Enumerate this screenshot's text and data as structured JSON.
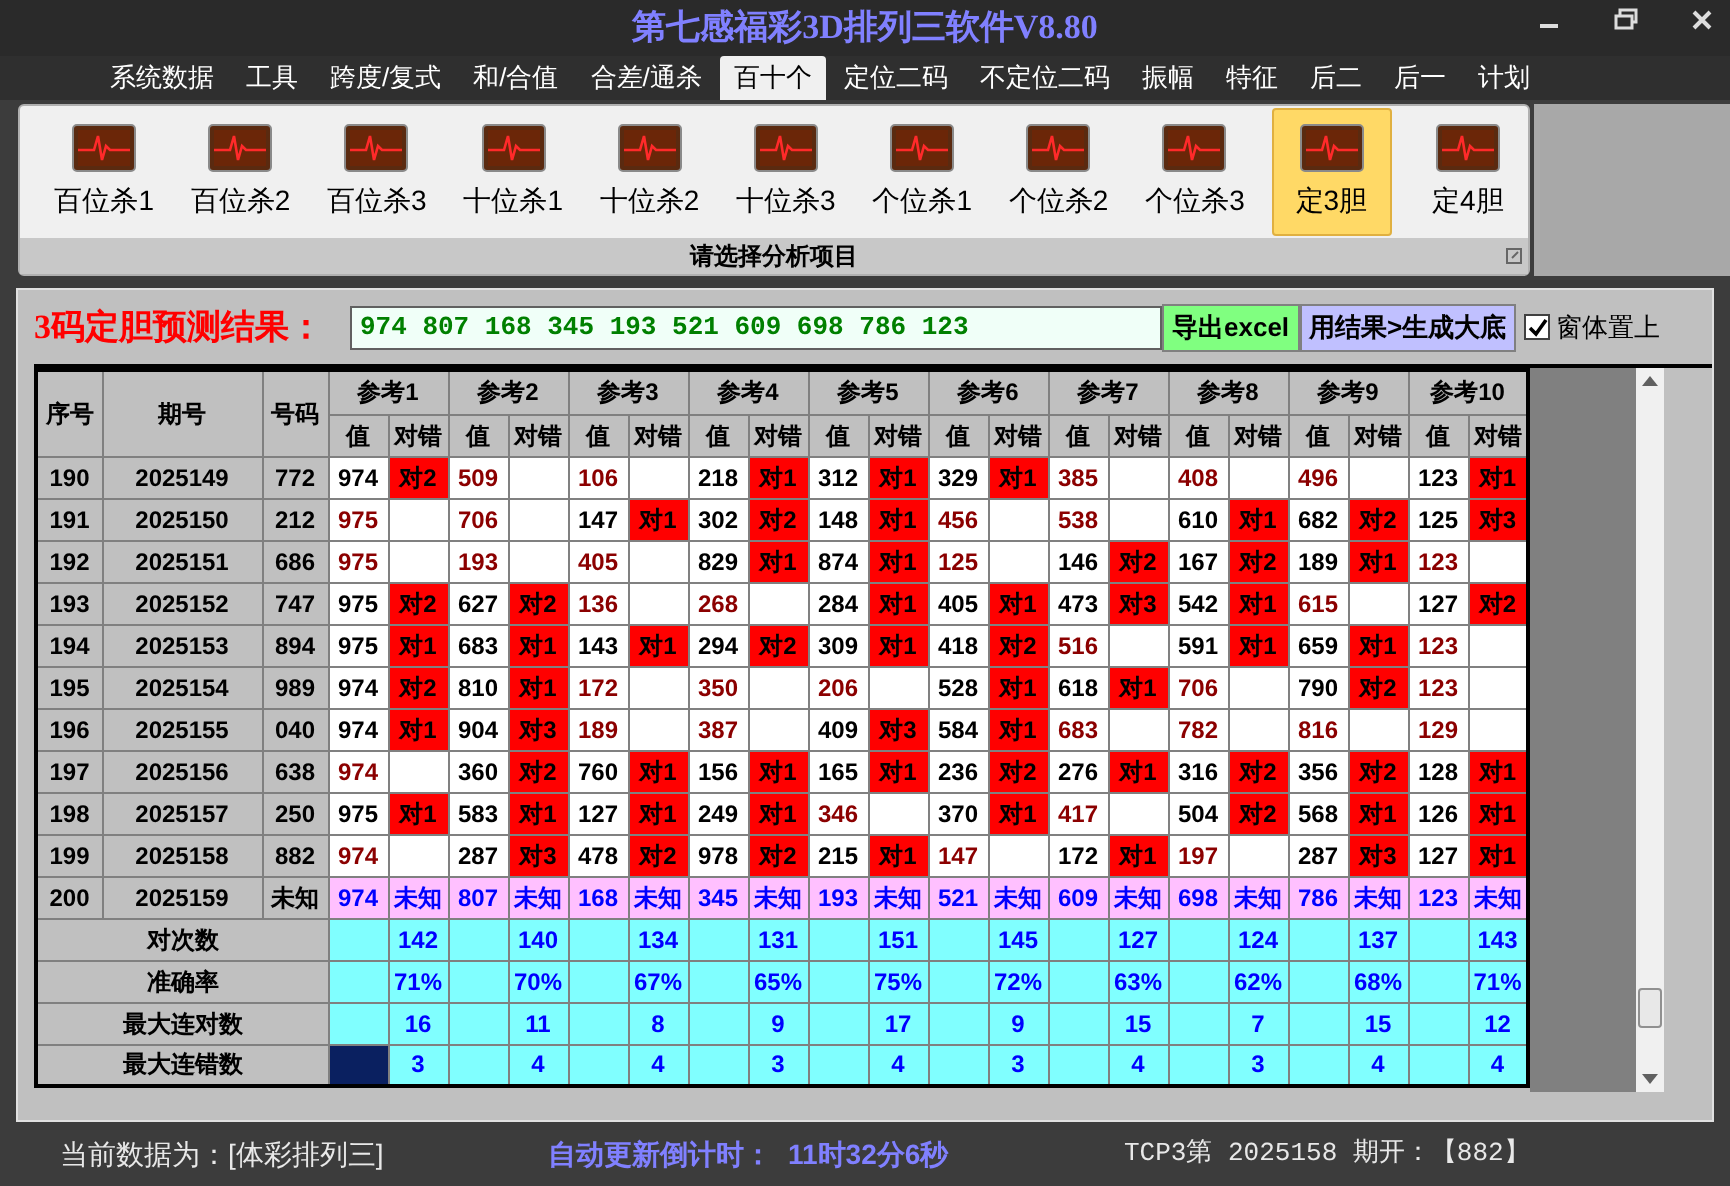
{
  "window": {
    "title": "第七感福彩3D排列三软件V8.80"
  },
  "menu": [
    {
      "label": "系统数据",
      "selected": false
    },
    {
      "label": "工具",
      "selected": false
    },
    {
      "label": "跨度/复式",
      "selected": false
    },
    {
      "label": "和/合值",
      "selected": false
    },
    {
      "label": "合差/通杀",
      "selected": false
    },
    {
      "label": "百十个",
      "selected": true
    },
    {
      "label": "定位二码",
      "selected": false
    },
    {
      "label": "不定位二码",
      "selected": false
    },
    {
      "label": "振幅",
      "selected": false
    },
    {
      "label": "特征",
      "selected": false
    },
    {
      "label": "后二",
      "selected": false
    },
    {
      "label": "后一",
      "selected": false
    },
    {
      "label": "计划",
      "selected": false
    }
  ],
  "ribbon": {
    "items": [
      {
        "label": "百位杀1",
        "selected": false
      },
      {
        "label": "百位杀2",
        "selected": false
      },
      {
        "label": "百位杀3",
        "selected": false
      },
      {
        "label": "十位杀1",
        "selected": false
      },
      {
        "label": "十位杀2",
        "selected": false
      },
      {
        "label": "十位杀3",
        "selected": false
      },
      {
        "label": "个位杀1",
        "selected": false
      },
      {
        "label": "个位杀2",
        "selected": false
      },
      {
        "label": "个位杀3",
        "selected": false
      },
      {
        "label": "定3胆",
        "selected": true
      },
      {
        "label": "定4胆",
        "selected": false
      }
    ],
    "group_label": "请选择分析项目"
  },
  "result": {
    "label": "3码定胆预测结果：",
    "value": "974 807 168 345 193 521 609 698 786 123",
    "buttons": [
      {
        "label": "导出excel",
        "kind": "export"
      },
      {
        "label": "用结果>生成大底",
        "kind": "generate"
      }
    ],
    "topmost": {
      "label": "窗体置上",
      "checked": true
    }
  },
  "table": {
    "columns": [
      "序号",
      "期号",
      "号码"
    ],
    "groups": [
      {
        "label": "参考1",
        "subcolumns": [
          "值",
          "对错"
        ]
      },
      {
        "label": "参考2",
        "subcolumns": [
          "值",
          "对错"
        ]
      },
      {
        "label": "参考3",
        "subcolumns": [
          "值",
          "对错"
        ]
      },
      {
        "label": "参考4",
        "subcolumns": [
          "值",
          "对错"
        ]
      },
      {
        "label": "参考5",
        "subcolumns": [
          "值",
          "对错"
        ]
      },
      {
        "label": "参考6",
        "subcolumns": [
          "值",
          "对错"
        ]
      },
      {
        "label": "参考7",
        "subcolumns": [
          "值",
          "对错"
        ]
      },
      {
        "label": "参考8",
        "subcolumns": [
          "值",
          "对错"
        ]
      },
      {
        "label": "参考9",
        "subcolumns": [
          "值",
          "对错"
        ]
      },
      {
        "label": "参考10",
        "subcolumns": [
          "值",
          "对错"
        ]
      }
    ],
    "rows": [
      {
        "no": "190",
        "issue": "2025149",
        "number": "772",
        "kind": "history",
        "cells": [
          {
            "value": "974",
            "result": "对2"
          },
          {
            "value": "509"
          },
          {
            "value": "106"
          },
          {
            "value": "218",
            "result": "对1"
          },
          {
            "value": "312",
            "result": "对1"
          },
          {
            "value": "329",
            "result": "对1"
          },
          {
            "value": "385"
          },
          {
            "value": "408"
          },
          {
            "value": "496"
          },
          {
            "value": "123",
            "result": "对1"
          }
        ]
      },
      {
        "no": "191",
        "issue": "2025150",
        "number": "212",
        "kind": "history",
        "cells": [
          {
            "value": "975"
          },
          {
            "value": "706"
          },
          {
            "value": "147",
            "result": "对1"
          },
          {
            "value": "302",
            "result": "对2"
          },
          {
            "value": "148",
            "result": "对1"
          },
          {
            "value": "456"
          },
          {
            "value": "538"
          },
          {
            "value": "610",
            "result": "对1"
          },
          {
            "value": "682",
            "result": "对2"
          },
          {
            "value": "125",
            "result": "对3"
          }
        ]
      },
      {
        "no": "192",
        "issue": "2025151",
        "number": "686",
        "kind": "history",
        "cells": [
          {
            "value": "975"
          },
          {
            "value": "193"
          },
          {
            "value": "405"
          },
          {
            "value": "829",
            "result": "对1"
          },
          {
            "value": "874",
            "result": "对1"
          },
          {
            "value": "125"
          },
          {
            "value": "146",
            "result": "对2"
          },
          {
            "value": "167",
            "result": "对2"
          },
          {
            "value": "189",
            "result": "对1"
          },
          {
            "value": "123"
          }
        ]
      },
      {
        "no": "193",
        "issue": "2025152",
        "number": "747",
        "kind": "history",
        "cells": [
          {
            "value": "975",
            "result": "对2"
          },
          {
            "value": "627",
            "result": "对2"
          },
          {
            "value": "136"
          },
          {
            "value": "268"
          },
          {
            "value": "284",
            "result": "对1"
          },
          {
            "value": "405",
            "result": "对1"
          },
          {
            "value": "473",
            "result": "对3"
          },
          {
            "value": "542",
            "result": "对1"
          },
          {
            "value": "615"
          },
          {
            "value": "127",
            "result": "对2"
          }
        ]
      },
      {
        "no": "194",
        "issue": "2025153",
        "number": "894",
        "kind": "history",
        "cells": [
          {
            "value": "975",
            "result": "对1"
          },
          {
            "value": "683",
            "result": "对1"
          },
          {
            "value": "143",
            "result": "对1"
          },
          {
            "value": "294",
            "result": "对2"
          },
          {
            "value": "309",
            "result": "对1"
          },
          {
            "value": "418",
            "result": "对2"
          },
          {
            "value": "516"
          },
          {
            "value": "591",
            "result": "对1"
          },
          {
            "value": "659",
            "result": "对1"
          },
          {
            "value": "123"
          }
        ]
      },
      {
        "no": "195",
        "issue": "2025154",
        "number": "989",
        "kind": "history",
        "cells": [
          {
            "value": "974",
            "result": "对2"
          },
          {
            "value": "810",
            "result": "对1"
          },
          {
            "value": "172"
          },
          {
            "value": "350"
          },
          {
            "value": "206"
          },
          {
            "value": "528",
            "result": "对1"
          },
          {
            "value": "618",
            "result": "对1"
          },
          {
            "value": "706"
          },
          {
            "value": "790",
            "result": "对2"
          },
          {
            "value": "123"
          }
        ]
      },
      {
        "no": "196",
        "issue": "2025155",
        "number": "040",
        "kind": "history",
        "cells": [
          {
            "value": "974",
            "result": "对1"
          },
          {
            "value": "904",
            "result": "对3"
          },
          {
            "value": "189"
          },
          {
            "value": "387"
          },
          {
            "value": "409",
            "result": "对3"
          },
          {
            "value": "584",
            "result": "对1"
          },
          {
            "value": "683"
          },
          {
            "value": "782"
          },
          {
            "value": "816"
          },
          {
            "value": "129"
          }
        ]
      },
      {
        "no": "197",
        "issue": "2025156",
        "number": "638",
        "kind": "history",
        "cells": [
          {
            "value": "974"
          },
          {
            "value": "360",
            "result": "对2"
          },
          {
            "value": "760",
            "result": "对1"
          },
          {
            "value": "156",
            "result": "对1"
          },
          {
            "value": "165",
            "result": "对1"
          },
          {
            "value": "236",
            "result": "对2"
          },
          {
            "value": "276",
            "result": "对1"
          },
          {
            "value": "316",
            "result": "对2"
          },
          {
            "value": "356",
            "result": "对2"
          },
          {
            "value": "128",
            "result": "对1"
          }
        ]
      },
      {
        "no": "198",
        "issue": "2025157",
        "number": "250",
        "kind": "history",
        "cells": [
          {
            "value": "975",
            "result": "对1"
          },
          {
            "value": "583",
            "result": "对1"
          },
          {
            "value": "127",
            "result": "对1"
          },
          {
            "value": "249",
            "result": "对1"
          },
          {
            "value": "346"
          },
          {
            "value": "370",
            "result": "对1"
          },
          {
            "value": "417"
          },
          {
            "value": "504",
            "result": "对2"
          },
          {
            "value": "568",
            "result": "对1"
          },
          {
            "value": "126",
            "result": "对1"
          }
        ]
      },
      {
        "no": "199",
        "issue": "2025158",
        "number": "882",
        "kind": "history",
        "cells": [
          {
            "value": "974"
          },
          {
            "value": "287",
            "result": "对3"
          },
          {
            "value": "478",
            "result": "对2"
          },
          {
            "value": "978",
            "result": "对2"
          },
          {
            "value": "215",
            "result": "对1"
          },
          {
            "value": "147"
          },
          {
            "value": "172",
            "result": "对1"
          },
          {
            "value": "197"
          },
          {
            "value": "287",
            "result": "对3"
          },
          {
            "value": "127",
            "result": "对1"
          }
        ]
      },
      {
        "no": "200",
        "issue": "2025159",
        "number": "未知",
        "kind": "pending",
        "cells": [
          {
            "value": "974",
            "result": "未知"
          },
          {
            "value": "807",
            "result": "未知"
          },
          {
            "value": "168",
            "result": "未知"
          },
          {
            "value": "345",
            "result": "未知"
          },
          {
            "value": "193",
            "result": "未知"
          },
          {
            "value": "521",
            "result": "未知"
          },
          {
            "value": "609",
            "result": "未知"
          },
          {
            "value": "698",
            "result": "未知"
          },
          {
            "value": "786",
            "result": "未知"
          },
          {
            "value": "123",
            "result": "未知"
          }
        ]
      }
    ],
    "stats": [
      {
        "label": "对次数",
        "selected": false,
        "values": [
          "142",
          "140",
          "134",
          "131",
          "151",
          "145",
          "127",
          "124",
          "137",
          "143"
        ]
      },
      {
        "label": "准确率",
        "selected": false,
        "values": [
          "71%",
          "70%",
          "67%",
          "65%",
          "75%",
          "72%",
          "63%",
          "62%",
          "68%",
          "71%"
        ]
      },
      {
        "label": "最大连对数",
        "selected": false,
        "values": [
          "16",
          "11",
          "8",
          "9",
          "17",
          "9",
          "15",
          "7",
          "15",
          "12"
        ]
      },
      {
        "label": "最大连错数",
        "selected": true,
        "values": [
          "3",
          "4",
          "4",
          "3",
          "4",
          "3",
          "4",
          "3",
          "4",
          "4"
        ]
      }
    ]
  },
  "status_bar": {
    "source": "当前数据为：[体彩排列三]",
    "countdown_label": "自动更新倒计时：",
    "countdown": "11时32分6秒",
    "draw": "TCP3第 2025158 期开：【882】"
  }
}
